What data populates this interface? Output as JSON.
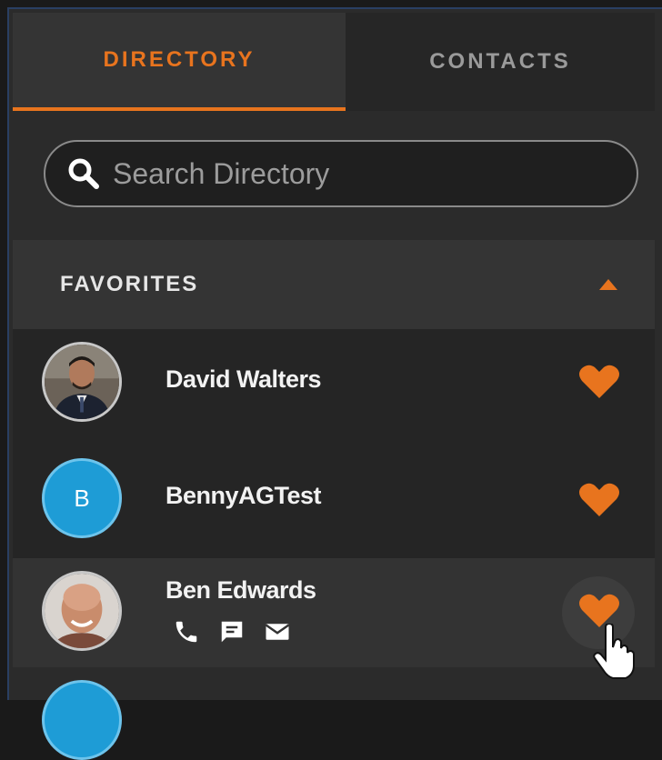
{
  "tabs": [
    {
      "label": "DIRECTORY",
      "active": true
    },
    {
      "label": "CONTACTS",
      "active": false
    }
  ],
  "search": {
    "placeholder": "Search Directory",
    "value": ""
  },
  "favorites": {
    "title": "FAVORITES",
    "collapse_icon": "caret-up-icon",
    "items": [
      {
        "name": "David Walters",
        "avatar": "photo",
        "favorite": true
      },
      {
        "name": "BennyAGTest",
        "avatar": "initial",
        "initial": "B",
        "favorite": true
      },
      {
        "name": "Ben Edwards",
        "avatar": "photo",
        "favorite": true,
        "hovered": true,
        "actions": [
          "phone-icon",
          "chat-icon",
          "email-icon"
        ]
      }
    ]
  },
  "colors": {
    "accent": "#e8741e",
    "avatar_blue": "#1e9cd6",
    "background": "#2b2b2b",
    "row_background": "#252525",
    "header_background": "#343434"
  }
}
